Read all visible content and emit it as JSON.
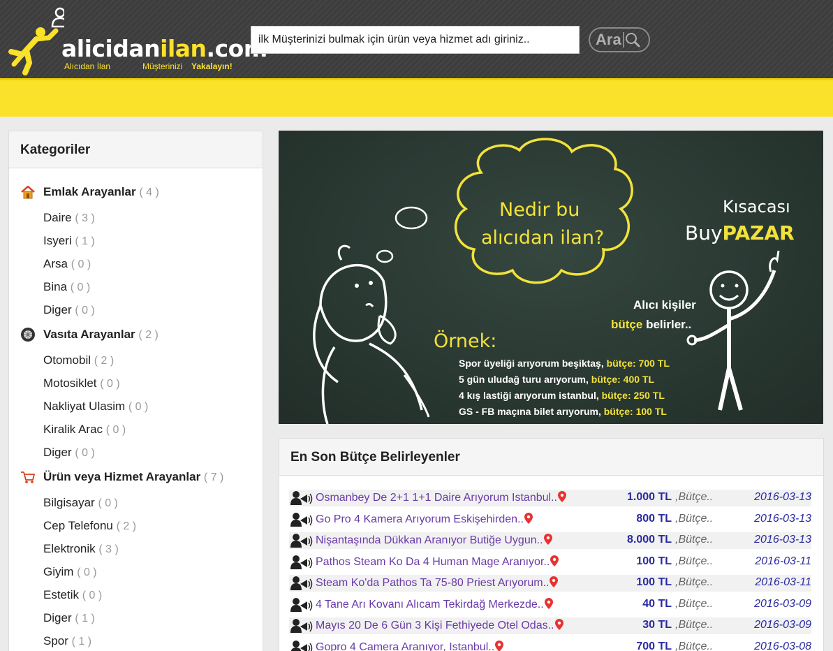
{
  "brand": {
    "name_part1": "alicidan",
    "name_part2": "ilan",
    "name_part3": ".com",
    "tagline_left": "Alıcıdan İlan",
    "tagline_mid": "Müşterinizi",
    "tagline_right": "Yakalayın!"
  },
  "search": {
    "placeholder": "ilk Müşterinizi bulmak için ürün veya hizmet adı giriniz..",
    "button_label": "Ara"
  },
  "sidebar": {
    "title": "Kategoriler",
    "categories": [
      {
        "name": "Emlak Arayanlar",
        "count": "( 4 )",
        "icon": "house-icon",
        "subs": [
          {
            "name": "Daire",
            "count": "( 3 )"
          },
          {
            "name": "Isyeri",
            "count": "( 1 )"
          },
          {
            "name": "Arsa",
            "count": "( 0 )"
          },
          {
            "name": "Bina",
            "count": "( 0 )"
          },
          {
            "name": "Diger",
            "count": "( 0 )"
          }
        ]
      },
      {
        "name": "Vasıta Arayanlar",
        "count": "( 2 )",
        "icon": "wheel-icon",
        "subs": [
          {
            "name": "Otomobil",
            "count": "( 2 )"
          },
          {
            "name": "Motosiklet",
            "count": "( 0 )"
          },
          {
            "name": "Nakliyat Ulasim",
            "count": "( 0 )"
          },
          {
            "name": "Kiralik Arac",
            "count": "( 0 )"
          },
          {
            "name": "Diger",
            "count": "( 0 )"
          }
        ]
      },
      {
        "name": "Ürün veya Hizmet Arayanlar",
        "count": "( 7 )",
        "icon": "cart-icon",
        "subs": [
          {
            "name": "Bilgisayar",
            "count": "( 0 )"
          },
          {
            "name": "Cep Telefonu",
            "count": "( 2 )"
          },
          {
            "name": "Elektronik",
            "count": "( 3 )"
          },
          {
            "name": "Giyim",
            "count": "( 0 )"
          },
          {
            "name": "Estetik",
            "count": "( 0 )"
          },
          {
            "name": "Diger",
            "count": "( 1 )"
          },
          {
            "name": "Spor",
            "count": "( 1 )"
          }
        ]
      }
    ]
  },
  "banner": {
    "question_line1": "Nedir bu",
    "question_line2": "alıcıdan ilan?",
    "summary_line1": "Kısacası",
    "summary_line2_prefix": "Buy",
    "summary_line2_bold": "PAZAR",
    "buyer_line1": "Alıcı kişiler",
    "buyer_bold": "bütçe",
    "buyer_rest": "belirler..",
    "example_title": "Örnek:",
    "examples": [
      {
        "text": "Spor üyeliği arıyorum beşiktaş, ",
        "budget": "bütçe: 700 TL"
      },
      {
        "text": "5 gün uludağ turu arıyorum, ",
        "budget": "bütçe: 400 TL"
      },
      {
        "text": "4 kış lastiği arıyorum istanbul, ",
        "budget": "bütçe: 250 TL"
      },
      {
        "text": "GS - FB maçına bilet arıyorum, ",
        "budget": "bütçe: 100 TL"
      }
    ]
  },
  "listing": {
    "title": "En Son Bütçe Belirleyenler",
    "rows": [
      {
        "title": "Osmanbey De 2+1 1+1 Daire Arıyorum Istanbul..",
        "price": "1.000 TL",
        "budget": ",Bütçe..",
        "date": "2016-03-13"
      },
      {
        "title": "Go Pro 4 Kamera Arıyorum Eskişehirden..",
        "price": "800 TL",
        "budget": ",Bütçe..",
        "date": "2016-03-13"
      },
      {
        "title": "Nişantaşında Dükkan Aranıyor Butiğe Uygun..",
        "price": "8.000 TL",
        "budget": ",Bütçe..",
        "date": "2016-03-13"
      },
      {
        "title": "Pathos Steam Ko Da 4 Human Mage Aranıyor..",
        "price": "100 TL",
        "budget": ",Bütçe..",
        "date": "2016-03-11"
      },
      {
        "title": "Steam Ko'da Pathos Ta 75-80 Priest Arıyorum..",
        "price": "100 TL",
        "budget": ",Bütçe..",
        "date": "2016-03-11"
      },
      {
        "title": "4 Tane Arı Kovanı Alıcam Tekirdağ Merkezde..",
        "price": "40 TL",
        "budget": ",Bütçe..",
        "date": "2016-03-09"
      },
      {
        "title": "Mayıs 20 De 6 Gün 3 Kişi Fethiyede Otel Odas..",
        "price": "30 TL",
        "budget": ",Bütçe..",
        "date": "2016-03-09"
      },
      {
        "title": "Gopro 4 Camera Aranıyor, Istanbul..",
        "price": "700 TL",
        "budget": ",Bütçe..",
        "date": "2016-03-08"
      }
    ]
  }
}
